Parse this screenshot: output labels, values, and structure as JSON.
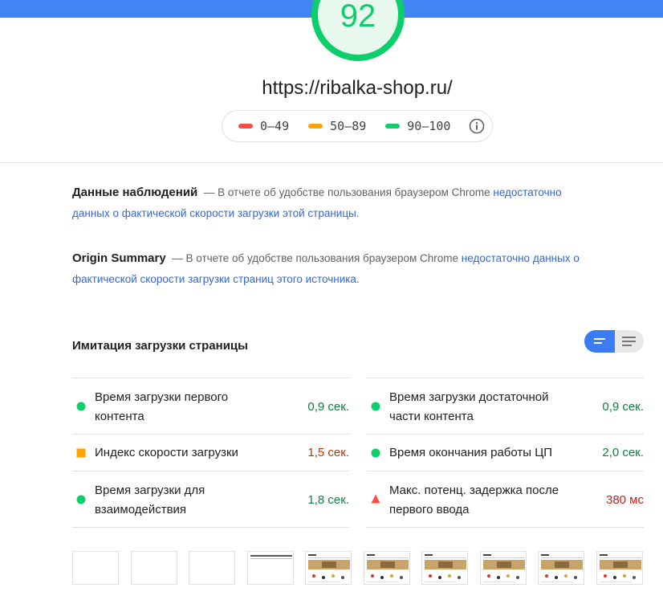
{
  "colors": {
    "accent": "#4285f4",
    "pass": "#0cce6b",
    "average": "#ffa400",
    "fail": "#ff4e42"
  },
  "gauge": {
    "score": "92",
    "fraction": 0.92
  },
  "page_url": "https://ribalka-shop.ru/",
  "legend": [
    {
      "label": "0–49",
      "color": "#ff4e42"
    },
    {
      "label": "50–89",
      "color": "#ffa400"
    },
    {
      "label": "90–100",
      "color": "#0cce6b"
    }
  ],
  "field_data": {
    "title": "Данные наблюдений",
    "dash": "—",
    "text": "В отчете об удобстве пользования браузером Chrome",
    "link": "недостаточно данных о фактической скорости загрузки этой страницы",
    "end": "."
  },
  "origin_summary": {
    "title": "Origin Summary",
    "dash": "—",
    "text": "В отчете об удобстве пользования браузером Chrome",
    "link": "недостаточно данных о фактической скорости загрузки страниц этого источника",
    "end": "."
  },
  "lab": {
    "title": "Имитация загрузки страницы"
  },
  "metrics_left": [
    {
      "label": "Время загрузки первого контента",
      "value": "0,9 сек.",
      "status": "pass"
    },
    {
      "label": "Индекс скорости загрузки",
      "value": "1,5 сек.",
      "status": "average"
    },
    {
      "label": "Время загрузки для взаимодействия",
      "value": "1,8 сек.",
      "status": "pass"
    }
  ],
  "metrics_right": [
    {
      "label": "Время загрузки достаточной части контента",
      "value": "0,9 сек.",
      "status": "pass"
    },
    {
      "label": "Время окончания работы ЦП",
      "value": "2,0 сек.",
      "status": "pass"
    },
    {
      "label": "Макс. потенц. задержка после первого ввода",
      "value": "380 мс",
      "status": "fail"
    }
  ],
  "filmstrip": [
    "blank",
    "blank",
    "blank",
    "header",
    "loaded",
    "loaded",
    "loaded",
    "loaded",
    "loaded",
    "loaded"
  ]
}
